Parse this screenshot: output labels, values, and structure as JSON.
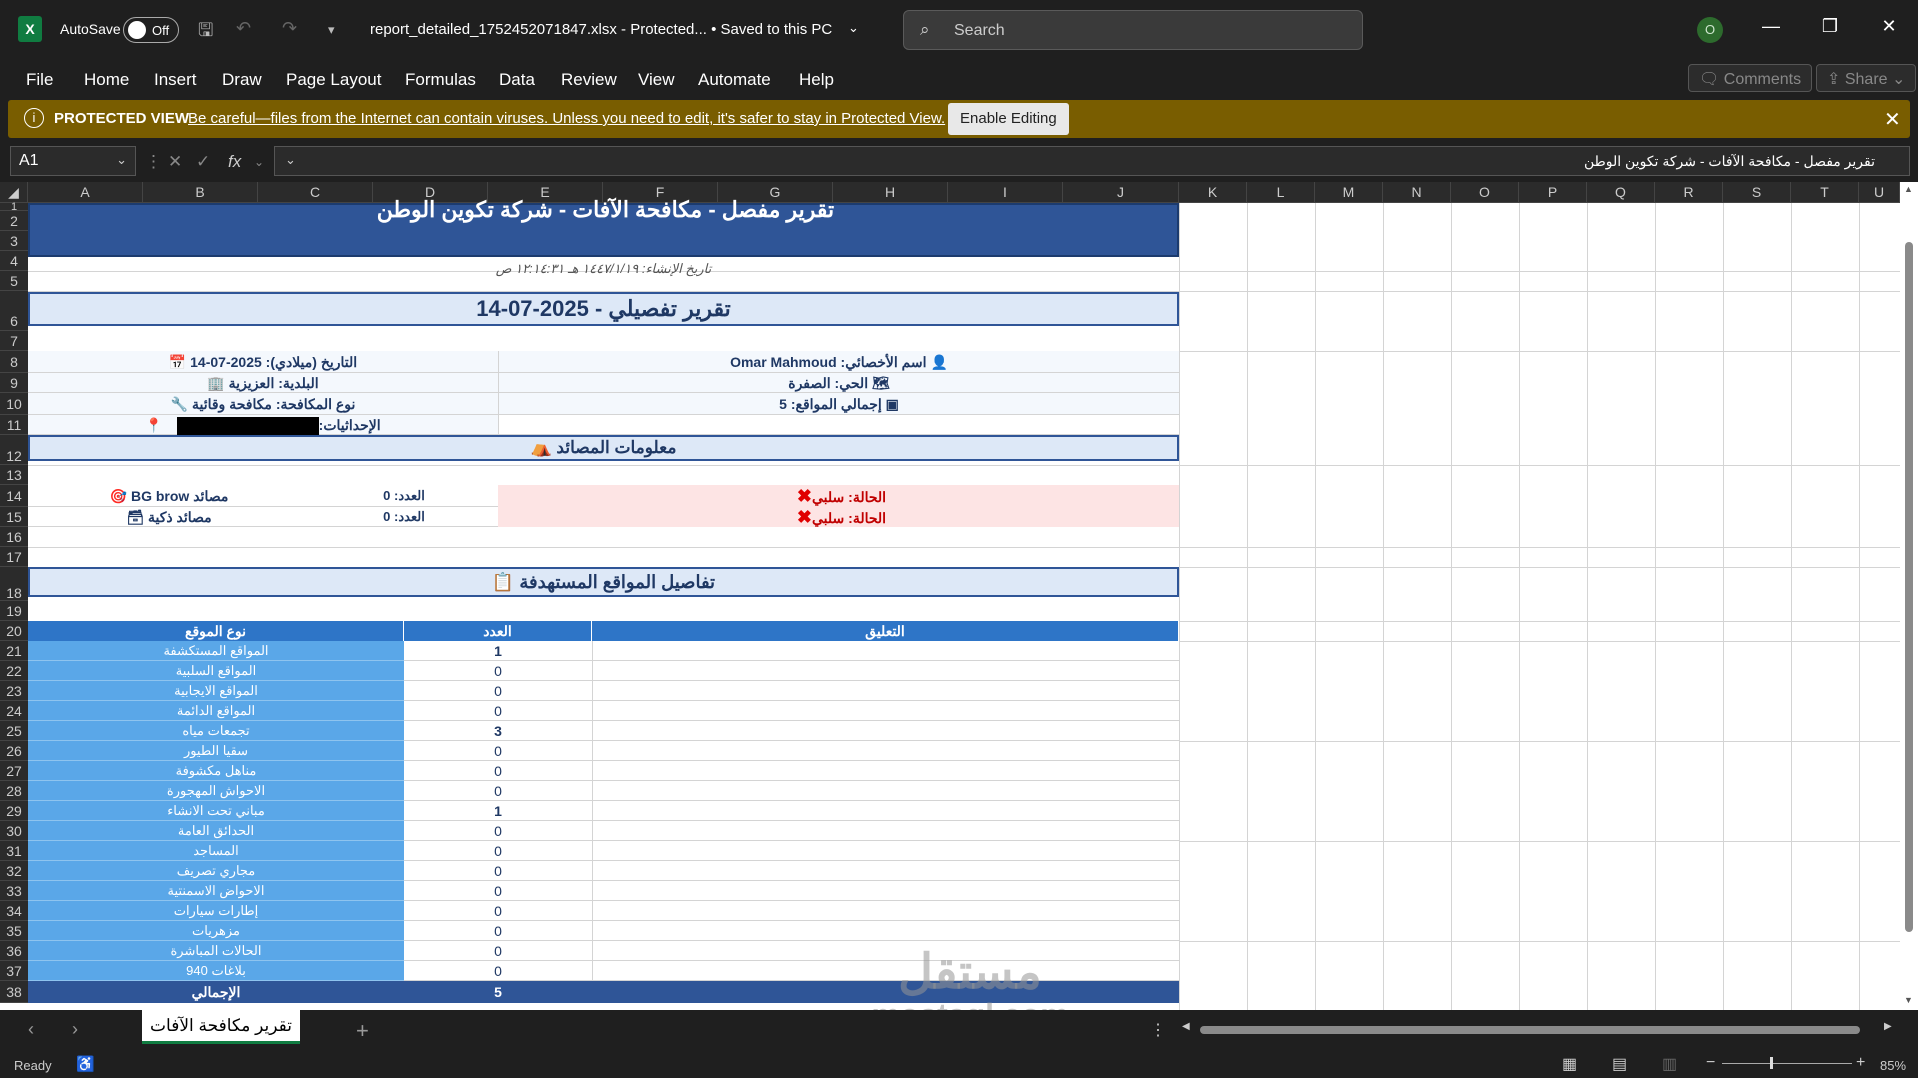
{
  "titlebar": {
    "autosave_label": "AutoSave",
    "autosave_state": "Off",
    "document_title": "report_detailed_1752452071847.xlsx  -  Protected...   •  Saved to this PC",
    "search_placeholder": "Search",
    "avatar_initial": "O"
  },
  "menu": {
    "items": [
      "File",
      "Home",
      "Insert",
      "Draw",
      "Page Layout",
      "Formulas",
      "Data",
      "Review",
      "View",
      "Automate",
      "Help"
    ],
    "comments": "Comments",
    "share": "Share"
  },
  "protected_view": {
    "label": "PROTECTED VIEW",
    "message": "Be careful—files from the Internet can contain viruses. Unless you need to edit, it's safer to stay in Protected View.",
    "enable_button": "Enable Editing"
  },
  "formula_bar": {
    "name_box": "A1",
    "fx": "fx",
    "content": "تقرير مفصل - مكافحة الآفات - شركة تكوين الوطن"
  },
  "columns": [
    "A",
    "B",
    "C",
    "D",
    "E",
    "F",
    "G",
    "H",
    "I",
    "J",
    "K",
    "L",
    "M",
    "N",
    "O",
    "P",
    "Q",
    "R",
    "S",
    "T",
    "U"
  ],
  "rows": [
    "1",
    "2",
    "3",
    "4",
    "5",
    "6",
    "7",
    "8",
    "9",
    "10",
    "11",
    "12",
    "13",
    "14",
    "15",
    "16",
    "17",
    "18",
    "19",
    "20",
    "21",
    "22",
    "23",
    "24",
    "25",
    "26",
    "27",
    "28",
    "29",
    "30",
    "31",
    "32",
    "33",
    "34",
    "35",
    "36",
    "37",
    "38"
  ],
  "report": {
    "banner_title": "تقرير مفصل - مكافحة الآفات - شركة تكوين الوطن",
    "created_date": "تاريخ الإنشاء: ١٤٤٧/١/١٩ هـ ١٢:١٤:٣١ ص",
    "detailed_title": "تقرير تفصيلي - 2025-07-14",
    "specialist": "اسم الأخصائي: Omar Mahmoud",
    "date": "التاريخ (ميلادي): 2025-07-14",
    "district": "الحي: الصفرة",
    "municipality": "البلدية: العزيزية",
    "total_sites": "إجمالي المواقع: 5",
    "control_type": "نوع المكافحة: مكافحة وقائية",
    "coordinates_label": "الإحداثيات:",
    "traps_section": "معلومات المصائد",
    "trap1_name": "مصائد BG brow",
    "trap1_count": "العدد: 0",
    "trap1_status": "الحالة: سلبي",
    "trap2_name": "مصائد ذكية",
    "trap2_count": "العدد: 0",
    "trap2_status": "الحالة: سلبي",
    "sites_section": "تفاصيل المواقع المستهدفة",
    "col_site_type": "نوع الموقع",
    "col_count": "العدد",
    "col_comment": "التعليق",
    "sites": [
      {
        "name": "المواقع المستكشفة",
        "count": "1"
      },
      {
        "name": "المواقع السلبية",
        "count": "0"
      },
      {
        "name": "المواقع الايجابية",
        "count": "0"
      },
      {
        "name": "المواقع الدائمة",
        "count": "0"
      },
      {
        "name": "تجمعات مياه",
        "count": "3"
      },
      {
        "name": "سقيا الطيور",
        "count": "0"
      },
      {
        "name": "مناهل مكشوفة",
        "count": "0"
      },
      {
        "name": "الاحواش المهجورة",
        "count": "0"
      },
      {
        "name": "مباني تحت الانشاء",
        "count": "1"
      },
      {
        "name": "الحدائق العامة",
        "count": "0"
      },
      {
        "name": "المساجد",
        "count": "0"
      },
      {
        "name": "مجاري تصريف",
        "count": "0"
      },
      {
        "name": "الاحواض الاسمنتية",
        "count": "0"
      },
      {
        "name": "إطارات سيارات",
        "count": "0"
      },
      {
        "name": "مزهريات",
        "count": "0"
      },
      {
        "name": "الحالات المباشرة",
        "count": "0"
      },
      {
        "name": "بلاغات 940",
        "count": "0"
      }
    ],
    "total_label": "الإجمالي",
    "total_value": "5"
  },
  "sheet_tab": "تقرير مكافحة الآفات",
  "status": {
    "ready": "Ready",
    "zoom": "85%"
  },
  "watermark": {
    "arabic": "مستقل",
    "latin": "mostaql.com"
  }
}
